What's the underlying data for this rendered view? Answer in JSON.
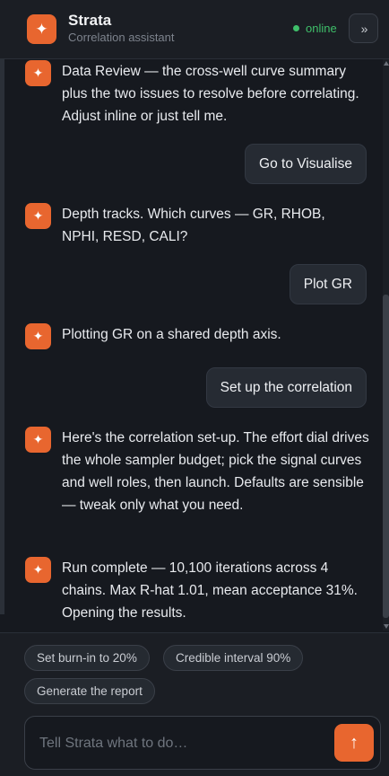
{
  "header": {
    "logo_glyph": "✦",
    "title": "Strata",
    "subtitle": "Correlation assistant",
    "status": "online",
    "expand_glyph": "»"
  },
  "colors": {
    "accent": "#e8662f",
    "status_online": "#3fbf6a",
    "background": "#16191f",
    "bubble": "#262b33"
  },
  "messages": [
    {
      "role": "assistant",
      "avatar_glyph": "✦",
      "text": "Data Review — the cross-well curve summary plus the two issues to resolve before correlating. Adjust inline or just tell me."
    },
    {
      "role": "user",
      "text": "Go to Visualise"
    },
    {
      "role": "assistant",
      "avatar_glyph": "✦",
      "text": "Depth tracks. Which curves — GR, RHOB, NPHI, RESD, CALI?"
    },
    {
      "role": "user",
      "text": "Plot GR"
    },
    {
      "role": "assistant",
      "avatar_glyph": "✦",
      "text": "Plotting GR on a shared depth axis."
    },
    {
      "role": "user",
      "text": "Set up the correlation"
    },
    {
      "role": "assistant",
      "avatar_glyph": "✦",
      "text": "Here's the correlation set-up. The effort dial drives the whole sampler budget; pick the signal curves and well roles, then launch. Defaults are sensible — tweak only what you need."
    },
    {
      "role": "assistant",
      "avatar_glyph": "✦",
      "text": "Run complete — 10,100 iterations across 4 chains. Max R-hat 1.01, mean acceptance 31%. Opening the results."
    }
  ],
  "suggestions": [
    "Set burn-in to 20%",
    "Credible interval 90%",
    "Generate the report"
  ],
  "composer": {
    "placeholder": "Tell Strata what to do…",
    "value": "",
    "send_glyph": "↑"
  }
}
